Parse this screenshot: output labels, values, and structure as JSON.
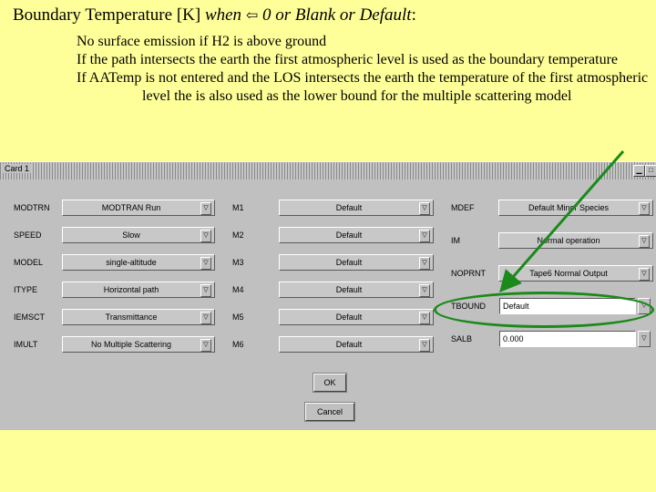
{
  "slide": {
    "title_prefix": "Boundary Temperature [K]",
    "title_when": "when",
    "title_arrow": "⇦",
    "title_rest": "0 or Blank or Default",
    "title_colon": ":",
    "notes": [
      "No surface emission if H2 is above ground",
      "If  the path intersects the earth the first atmospheric level is used as the boundary temperature",
      "If AATemp is not entered and the LOS intersects the earth the temperature of the first atmospheric level the is also used as the lower bound for the multiple scattering model"
    ]
  },
  "window": {
    "title": "Card 1",
    "minimize_icon": "minimize-icon",
    "maximize_icon": "maximize-icon"
  },
  "fields": {
    "modtrn": {
      "label": "MODTRN",
      "value": "MODTRAN Run"
    },
    "speed": {
      "label": "SPEED",
      "value": "Slow"
    },
    "model": {
      "label": "MODEL",
      "value": "single-altitude"
    },
    "itype": {
      "label": "ITYPE",
      "value": "Horizontal path"
    },
    "iemsct": {
      "label": "IEMSCT",
      "value": "Transmittance"
    },
    "imult": {
      "label": "IMULT",
      "value": "No Multiple Scattering"
    },
    "m1": {
      "label": "M1",
      "value": "Default"
    },
    "m2": {
      "label": "M2",
      "value": "Default"
    },
    "m3": {
      "label": "M3",
      "value": "Default"
    },
    "m4": {
      "label": "M4",
      "value": "Default"
    },
    "m5": {
      "label": "M5",
      "value": "Default"
    },
    "m6": {
      "label": "M6",
      "value": "Default"
    },
    "mdef": {
      "label": "MDEF",
      "value": "Default Minor Species"
    },
    "im": {
      "label": "IM",
      "value": "Normal operation"
    },
    "noprnt": {
      "label": "NOPRNT",
      "value": "Tape6 Normal Output"
    },
    "tbound": {
      "label": "TBOUND",
      "value": "Default"
    },
    "salb": {
      "label": "SALB",
      "value": "0.000"
    }
  },
  "buttons": {
    "ok": "OK",
    "cancel": "Cancel"
  },
  "colors": {
    "slide_background": "#ffff99",
    "highlight_green": "#1a8a1a",
    "dialog_gray": "#c0c0c0"
  }
}
